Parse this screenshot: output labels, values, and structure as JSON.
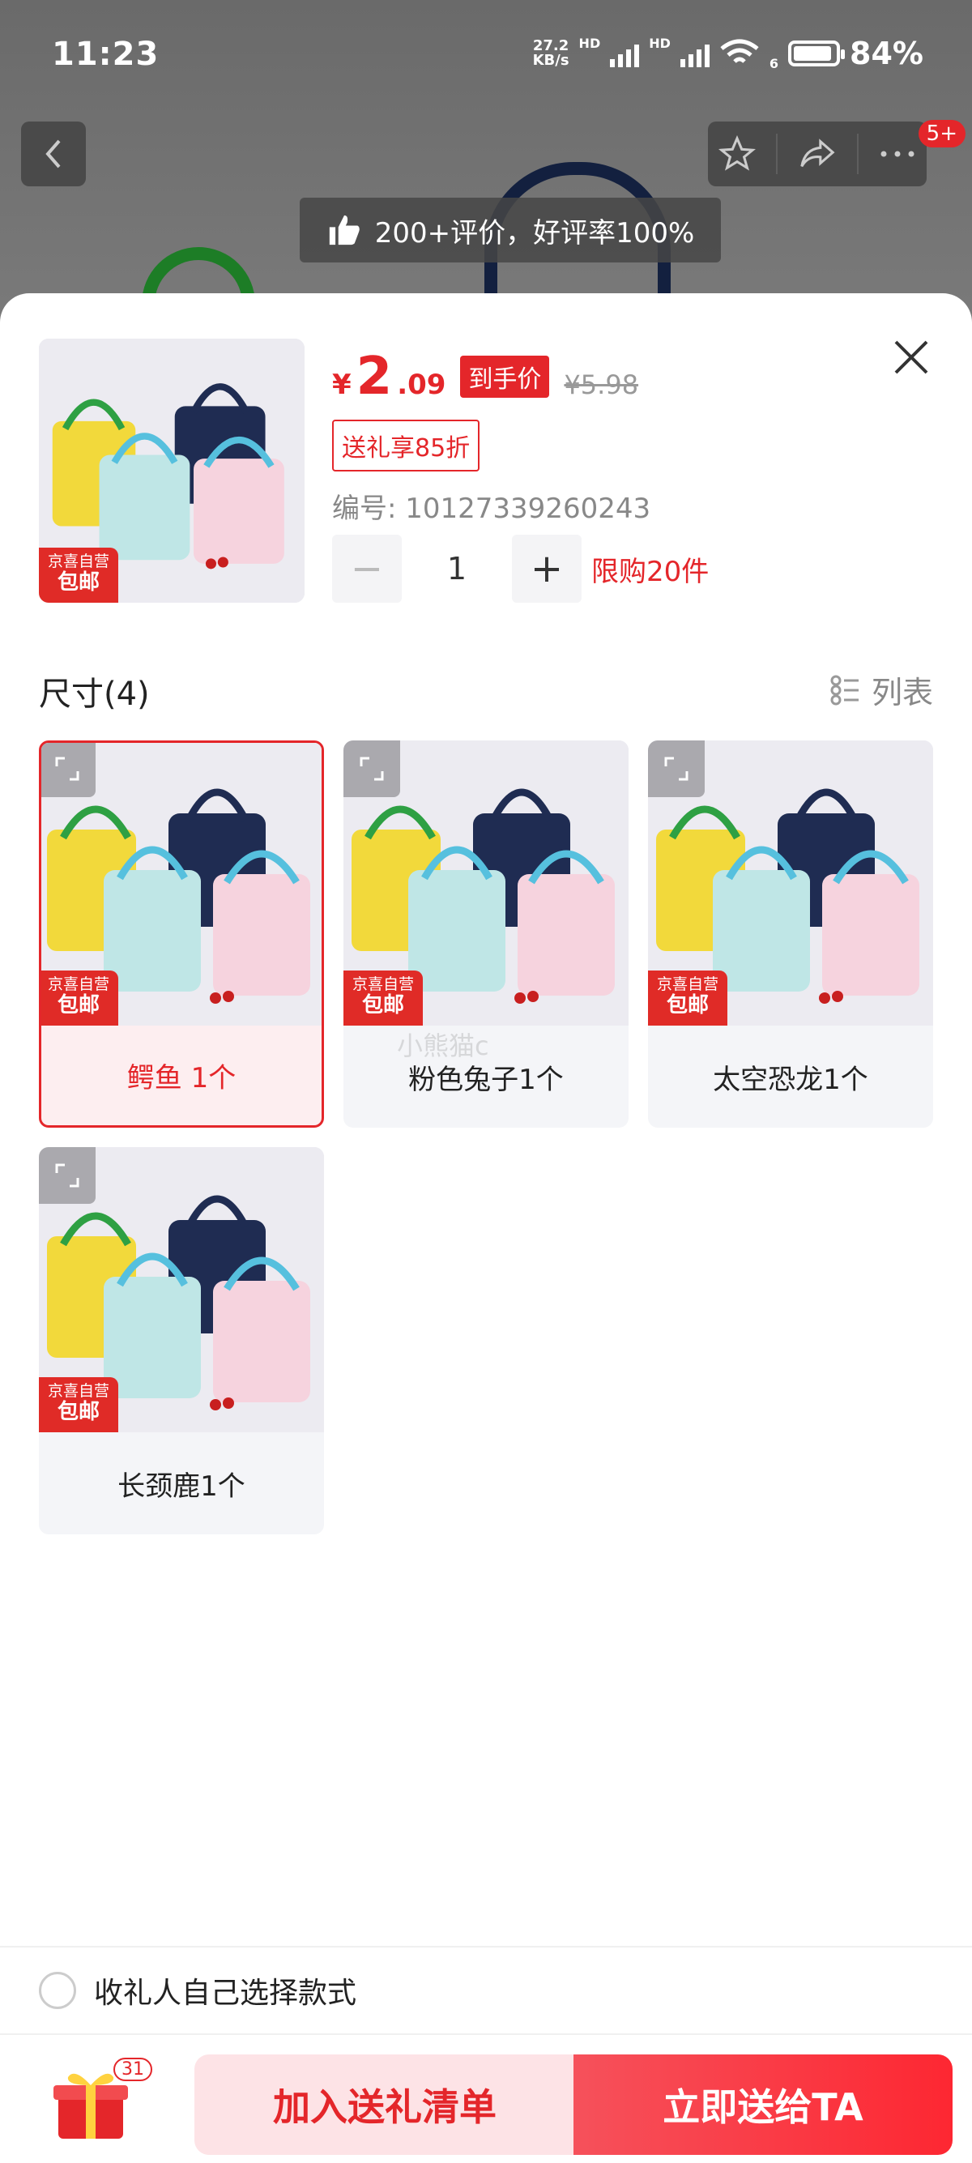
{
  "status": {
    "time": "11:23",
    "net_speed_top": "27.2",
    "net_speed_bottom": "KB/s",
    "hd1": "HD",
    "hd2": "HD",
    "wifi_sub": "6",
    "battery": "84%"
  },
  "header": {
    "review_text": "200+评价，好评率100%",
    "badge": "5+"
  },
  "product": {
    "yen": "¥",
    "price_int": "2",
    "price_dec": ".09",
    "price_tag": "到手价",
    "orig_price": "¥5.98",
    "gift_discount": "送礼享85折",
    "sku_no": "编号: 10127339260243",
    "qty_minus": "−",
    "qty": "1",
    "qty_plus": "+",
    "limit": "限购20件",
    "badge_line1": "京喜自营",
    "badge_line2": "包邮"
  },
  "options": {
    "title": "尺寸(4)",
    "list_label": "列表",
    "items": [
      {
        "label": "鳄鱼  1个",
        "selected": true
      },
      {
        "label": "粉色兔子1个",
        "selected": false
      },
      {
        "label": "太空恐龙1个",
        "selected": false
      },
      {
        "label": "长颈鹿1个",
        "selected": false
      }
    ],
    "watermark": "小熊猫c"
  },
  "recipient_option": "收礼人自己选择款式",
  "bottom": {
    "gift_count": "31",
    "add_label": "加入送礼清单",
    "send_label": "立即送给TA"
  },
  "colors": {
    "accent": "#e4262a",
    "add_bg": "#fde3e6"
  }
}
